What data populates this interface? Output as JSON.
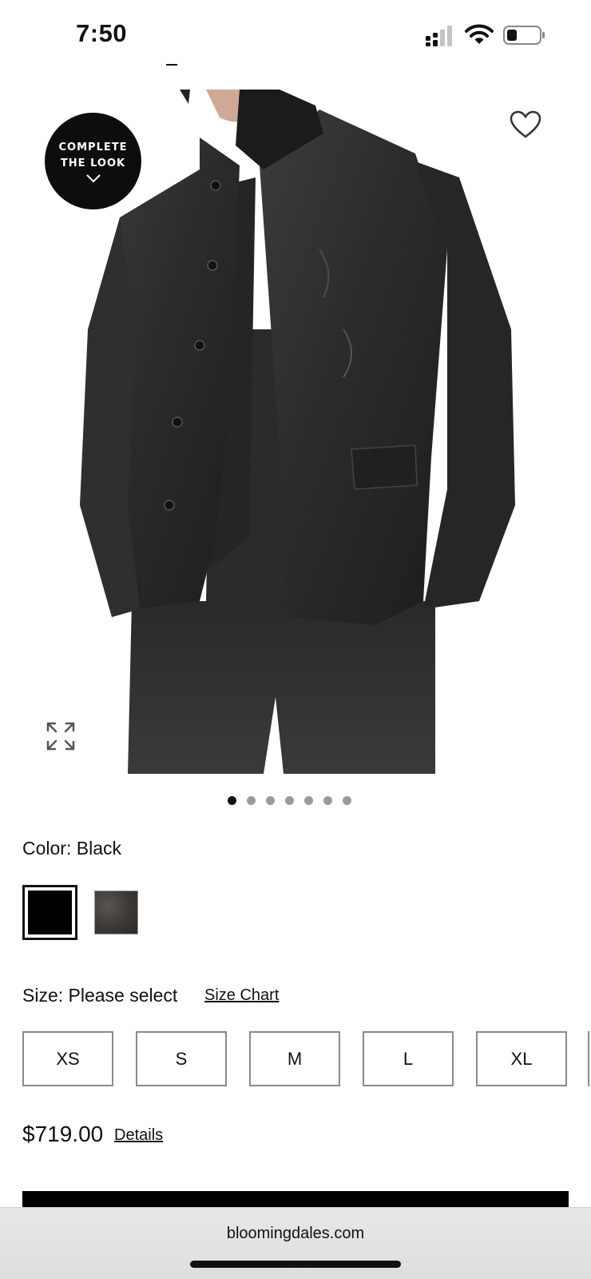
{
  "status_bar": {
    "time": "7:50"
  },
  "product": {
    "complete_look_line1": "COMPLETE",
    "complete_look_line2": "THE LOOK",
    "image_count": 7,
    "active_image_index": 0
  },
  "color": {
    "label": "Color: Black",
    "swatches": [
      "black",
      "dark-brown"
    ],
    "selected": "black"
  },
  "size": {
    "label": "Size: Please select",
    "chart_link": "Size Chart",
    "options": [
      "XS",
      "S",
      "M",
      "L",
      "XL"
    ]
  },
  "price": {
    "amount": "$719.00",
    "details_link": "Details"
  },
  "browser": {
    "url": "bloomingdales.com"
  },
  "icons": {
    "wishlist": "heart-icon",
    "expand": "expand-icon",
    "complete_look_chevron": "chevron-down-icon",
    "signal": "cellular-signal-icon",
    "wifi": "wifi-icon",
    "battery": "battery-icon"
  }
}
